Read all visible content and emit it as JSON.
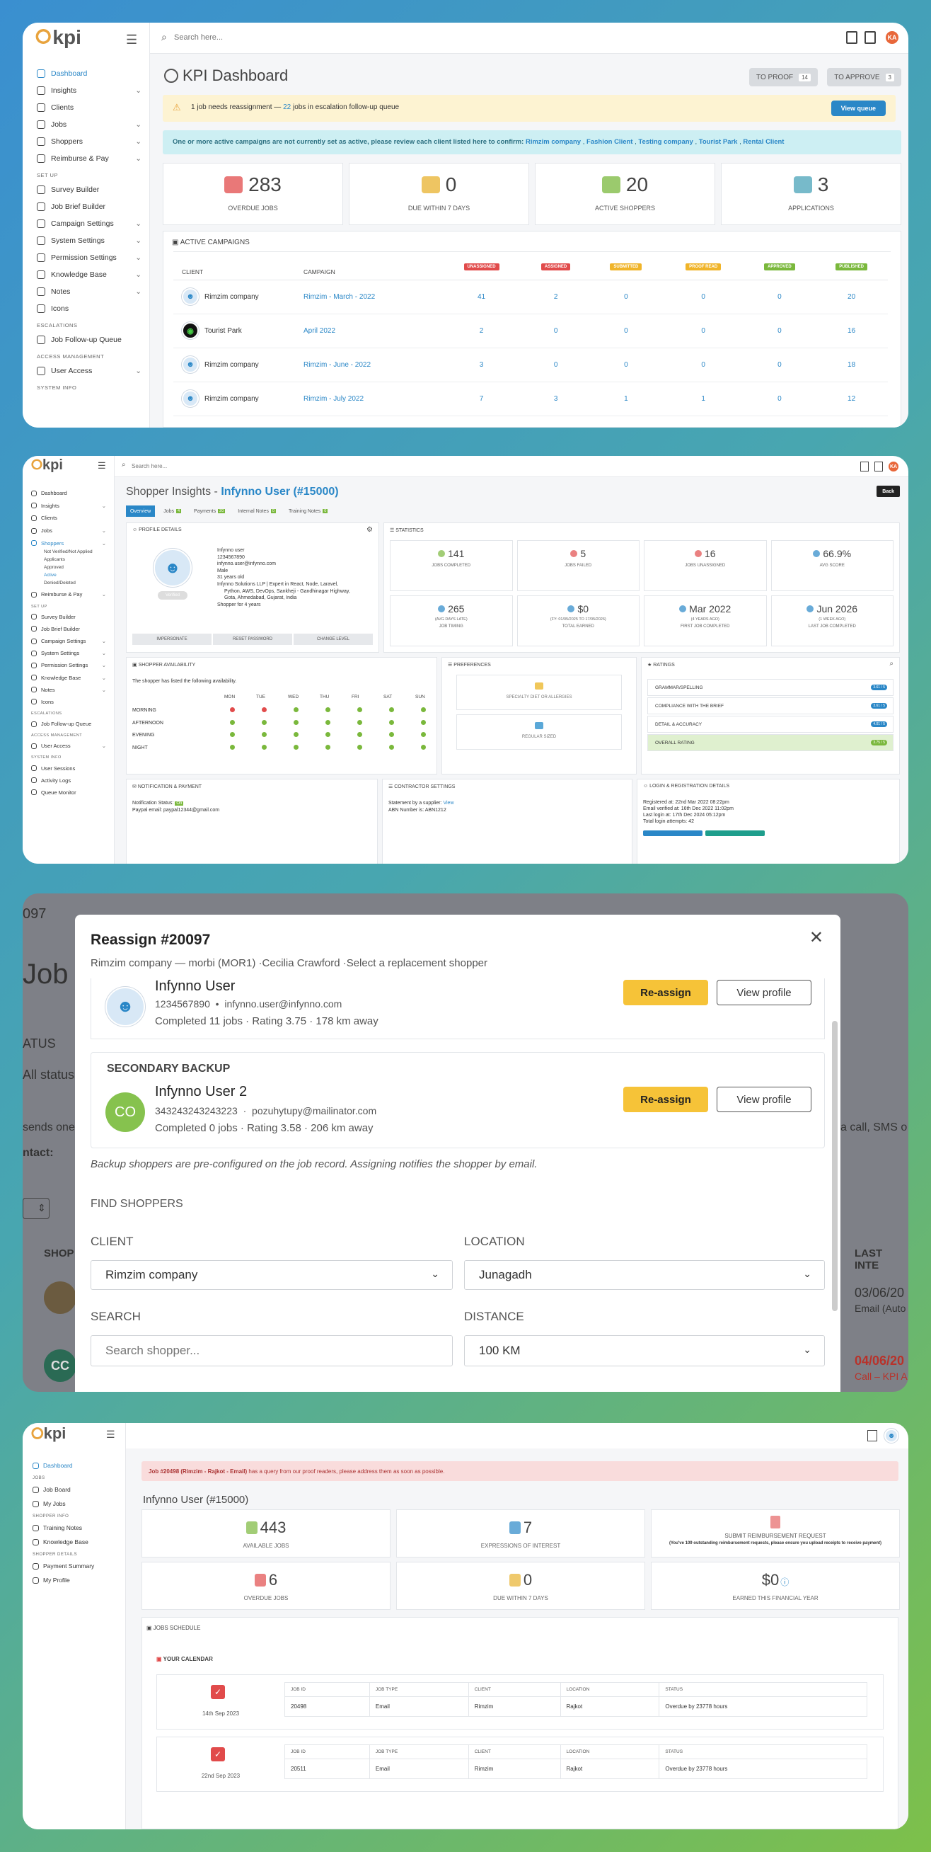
{
  "brand": "kpi",
  "p1": {
    "search_placeholder": "Search here...",
    "user_initials": "KA",
    "sidebar": [
      {
        "label": "Dashboard",
        "active": true
      },
      {
        "label": "Insights",
        "chev": true
      },
      {
        "label": "Clients"
      },
      {
        "label": "Jobs",
        "chev": true
      },
      {
        "label": "Shoppers",
        "chev": true
      },
      {
        "label": "Reimburse & Pay",
        "chev": true
      }
    ],
    "sidebar_setup_title": "SET UP",
    "sidebar_setup": [
      {
        "label": "Survey Builder"
      },
      {
        "label": "Job Brief Builder"
      },
      {
        "label": "Campaign Settings",
        "chev": true
      },
      {
        "label": "System Settings",
        "chev": true
      },
      {
        "label": "Permission Settings",
        "chev": true
      },
      {
        "label": "Knowledge Base",
        "chev": true
      },
      {
        "label": "Notes",
        "chev": true
      },
      {
        "label": "Icons"
      }
    ],
    "sidebar_esc_title": "ESCALATIONS",
    "sidebar_esc": [
      {
        "label": "Job Follow-up Queue"
      }
    ],
    "sidebar_access_title": "ACCESS MANAGEMENT",
    "sidebar_access": [
      {
        "label": "User Access",
        "chev": true
      }
    ],
    "sidebar_sys_title": "SYSTEM INFO",
    "title": "KPI Dashboard",
    "to_proof_label": "TO PROOF",
    "to_proof_count": "14",
    "to_approve_label": "TO APPROVE",
    "to_approve_count": "3",
    "alert_pre": "1 job needs reassignment —",
    "alert_num": "22",
    "alert_post": "jobs in escalation follow-up queue",
    "alert_btn": "View queue",
    "info_text": "One or more active campaigns are not currently set as active, please review each client listed here to confirm:",
    "info_links": [
      "Rimzim company",
      "Fashion Client",
      "Testing company",
      "Tourist Park",
      "Rental Client"
    ],
    "stats": [
      {
        "value": "283",
        "label": "OVERDUE JOBS",
        "icon": "calendar-alert-icon"
      },
      {
        "value": "0",
        "label": "DUE WITHIN 7 DAYS",
        "icon": "calendar-clock-icon"
      },
      {
        "value": "20",
        "label": "ACTIVE SHOPPERS",
        "icon": "users-icon"
      },
      {
        "value": "3",
        "label": "APPLICATIONS",
        "icon": "user-group-icon"
      }
    ],
    "campaigns_title": "ACTIVE CAMPAIGNS",
    "col_client": "CLIENT",
    "col_campaign": "CAMPAIGN",
    "status_cols": [
      {
        "label": "UNASSIGNED",
        "color": "#e14b4b"
      },
      {
        "label": "ASSIGNED",
        "color": "#e14b4b"
      },
      {
        "label": "SUBMITTED",
        "color": "#f0b429"
      },
      {
        "label": "PROOF READ",
        "color": "#f0b429"
      },
      {
        "label": "APPROVED",
        "color": "#7ab83c"
      },
      {
        "label": "PUBLISHED",
        "color": "#7ab83c"
      }
    ],
    "rows": [
      {
        "client": "Rimzim company",
        "campaign": "Rimzim - March - 2022",
        "vals": [
          "41",
          "2",
          "0",
          "0",
          "0",
          "20"
        ]
      },
      {
        "client": "Tourist Park",
        "campaign": "April 2022",
        "vals": [
          "2",
          "0",
          "0",
          "0",
          "0",
          "16"
        ]
      },
      {
        "client": "Rimzim company",
        "campaign": "Rimzim - June - 2022",
        "vals": [
          "3",
          "0",
          "0",
          "0",
          "0",
          "18"
        ]
      },
      {
        "client": "Rimzim company",
        "campaign": "Rimzim - July 2022",
        "vals": [
          "7",
          "3",
          "1",
          "1",
          "0",
          "12"
        ]
      }
    ]
  },
  "p2": {
    "search_placeholder": "Search here...",
    "user_initials": "KA",
    "sidebar": [
      {
        "label": "Dashboard"
      },
      {
        "label": "Insights",
        "chev": true
      },
      {
        "label": "Clients"
      },
      {
        "label": "Jobs",
        "chev": true
      },
      {
        "label": "Shoppers",
        "chev": true,
        "active": true
      }
    ],
    "sidebar_sub": [
      "Not Verified/Not Applied",
      "Applicants",
      "Approved",
      "Active",
      "Denied/Deleted"
    ],
    "sidebar_b": [
      {
        "label": "Reimburse & Pay",
        "chev": true
      }
    ],
    "setup_title": "SET UP",
    "sidebar_setup": [
      {
        "label": "Survey Builder"
      },
      {
        "label": "Job Brief Builder"
      },
      {
        "label": "Campaign Settings",
        "chev": true
      },
      {
        "label": "System Settings",
        "chev": true
      },
      {
        "label": "Permission Settings",
        "chev": true
      },
      {
        "label": "Knowledge Base",
        "chev": true
      },
      {
        "label": "Notes",
        "chev": true
      },
      {
        "label": "Icons"
      }
    ],
    "esc_title": "ESCALATIONS",
    "sidebar_esc": [
      {
        "label": "Job Follow-up Queue"
      }
    ],
    "access_title": "ACCESS MANAGEMENT",
    "sidebar_access": [
      {
        "label": "User Access",
        "chev": true
      }
    ],
    "sys_title": "SYSTEM INFO",
    "sidebar_sys": [
      {
        "label": "User Sessions"
      },
      {
        "label": "Activity Logs"
      },
      {
        "label": "Queue Monitor"
      }
    ],
    "title_pre": "Shopper Insights -",
    "title_user": "Infynno User (#15000)",
    "back": "Back",
    "tabs": [
      {
        "label": "Overview",
        "active": true
      },
      {
        "label": "Jobs",
        "count": "4"
      },
      {
        "label": "Payments",
        "count": "20"
      },
      {
        "label": "Internal Notes",
        "count": "0"
      },
      {
        "label": "Training Notes",
        "count": "0"
      }
    ],
    "profile_title": "PROFILE DETAILS",
    "profile_lines": [
      "Infynno user",
      "1234567890",
      "infynno.user@infynno.com",
      "Male",
      "31 years old",
      "Infynno Solutions LLP | Expert in React, Node, Laravel,",
      "Python, AWS, DevOps, Sankheji - Gandhinagar Highway,",
      "Gota, Ahmedabad, Gujarat, India",
      "Shopper for 4 years"
    ],
    "profile_status": "Verified",
    "profile_actions": [
      "IMPERSONATE",
      "RESET PASSWORD",
      "CHANGE LEVEL"
    ],
    "statistics_title": "STATISTICS",
    "stats": [
      {
        "value": "141",
        "label": "JOBS COMPLETED",
        "sub": ""
      },
      {
        "value": "5",
        "label": "JOBS FAILED",
        "sub": ""
      },
      {
        "value": "16",
        "label": "JOBS UNASSIGNED",
        "sub": ""
      },
      {
        "value": "66.9%",
        "label": "AVG SCORE",
        "sub": ""
      },
      {
        "value": "265",
        "label": "JOB TIMING",
        "sub": "(AVG DAYS LATE)"
      },
      {
        "value": "$0",
        "label": "TOTAL EARNED",
        "sub": "(FY: 01/05/2025 TO 17/05/2026)"
      },
      {
        "value": "Mar 2022",
        "label": "FIRST JOB COMPLETED",
        "sub": "(4 YEARS AGO)"
      },
      {
        "value": "Jun 2026",
        "label": "LAST JOB COMPLETED",
        "sub": "(1 WEEK AGO)"
      }
    ],
    "avail_title": "SHOPPER AVAILABILITY",
    "avail_note": "The shopper has listed the following availability.",
    "days": [
      "MON",
      "TUE",
      "WED",
      "THU",
      "FRI",
      "SAT",
      "SUN"
    ],
    "avail_rows": [
      {
        "label": "MORNING",
        "dots": [
          "r",
          "r",
          "g",
          "g",
          "g",
          "g",
          "g"
        ]
      },
      {
        "label": "AFTERNOON",
        "dots": [
          "g",
          "g",
          "g",
          "g",
          "g",
          "g",
          "g"
        ]
      },
      {
        "label": "EVENING",
        "dots": [
          "g",
          "g",
          "g",
          "g",
          "g",
          "g",
          "g"
        ]
      },
      {
        "label": "NIGHT",
        "dots": [
          "g",
          "g",
          "g",
          "g",
          "g",
          "g",
          "g"
        ]
      }
    ],
    "pref_title": "PREFERENCES",
    "prefs": [
      "SPECIALTY DIET OR ALLERGIES",
      "REGULAR SIZED"
    ],
    "ratings_title": "RATINGS",
    "ratings": [
      {
        "label": "GRAMMAR/SPELLING",
        "score": "3.61 / 5"
      },
      {
        "label": "COMPLIANCE WITH THE BRIEF",
        "score": "3.61 / 5"
      },
      {
        "label": "DETAIL & ACCURACY",
        "score": "4.01 / 5"
      },
      {
        "label": "OVERALL RATING",
        "score": "3.75 / 5"
      }
    ],
    "notif_title": "NOTIFICATION & PAYMENT",
    "notif_status_label": "Notification Status:",
    "notif_status": "On",
    "paypal_label": "Paypal email:",
    "paypal": "paypal12344@gmail.com",
    "contractor_title": "CONTRACTOR SETTINGS",
    "statement_label": "Statement by a supplier:",
    "statement_link": "View",
    "abn_label": "ABN Number is:",
    "abn": "ABN1212",
    "login_title": "LOGIN & REGISTRATION DETAILS",
    "login_lines": [
      {
        "k": "Registered at:",
        "v": "22nd Mar 2022 08:22pm"
      },
      {
        "k": "Email verified at:",
        "v": "16th Dec 2022 11:02pm"
      },
      {
        "k": "Last login at:",
        "v": "17th Dec 2024 05:12pm"
      },
      {
        "k": "Total login attempts:",
        "v": "42"
      }
    ]
  },
  "p3": {
    "bg_code": "097",
    "bg_heading": "Job",
    "bg_status": "ATUS",
    "bg_all": "All status",
    "bg_sends": "sends one",
    "bg_ntact": "ntact:",
    "bg_sms": "a call, SMS o",
    "bg_shop": "SHOP",
    "bg_last": "LAST INTE",
    "bg_date1": "03/06/20",
    "bg_email": "Email (Auto",
    "bg_date2": "04/06/20",
    "bg_call": "Call – KPI A",
    "bg_cc": "CC",
    "modal_title": "Reassign #20097",
    "modal_sub": "Rimzim company — morbi (MOR1) ·Cecilia Crawford ·Select a replacement shopper",
    "s1": {
      "name": "Infynno User",
      "phone": "1234567890",
      "email": "infynno.user@infynno.com",
      "completed": "Completed 11 jobs",
      "rating": "Rating 3.75",
      "distance": "178 km away"
    },
    "secondary_title": "SECONDARY BACKUP",
    "s2": {
      "initials": "CO",
      "name": "Infynno User 2",
      "phone": "343243243243223",
      "email": "pozuhytupy@mailinator.com",
      "completed": "Completed 0 jobs",
      "rating": "Rating 3.58",
      "distance": "206 km away"
    },
    "reassign": "Re-assign",
    "view_profile": "View profile",
    "backup_note": "Backup shoppers are pre-configured on the job record. Assigning notifies the shopper by email.",
    "find_title": "FIND SHOPPERS",
    "client_label": "CLIENT",
    "client_value": "Rimzim company",
    "location_label": "LOCATION",
    "location_value": "Junagadh",
    "search_label": "SEARCH",
    "search_placeholder": "Search shopper...",
    "distance_label": "DISTANCE",
    "distance_value": "100 KM"
  },
  "p4": {
    "sidebar": [
      {
        "label": "Dashboard",
        "active": true
      }
    ],
    "jobs_title": "JOBS",
    "jobs": [
      {
        "label": "Job Board"
      },
      {
        "label": "My Jobs"
      }
    ],
    "info_title": "SHOPPER INFO",
    "info": [
      {
        "label": "Training Notes"
      },
      {
        "label": "Knowledge Base"
      }
    ],
    "details_title": "SHOPPER DETAILS",
    "details": [
      {
        "label": "Payment Summary"
      },
      {
        "label": "My Profile"
      }
    ],
    "alert_bold": "Job #20498 (Rimzim - Rajkot - Email)",
    "alert_rest": "has a query from our proof readers, please address them as soon as possible.",
    "user_title": "Infynno User (#15000)",
    "stats": [
      {
        "value": "443",
        "label": "AVAILABLE JOBS"
      },
      {
        "value": "7",
        "label": "EXPRESSIONS OF INTEREST"
      },
      {
        "value": "6",
        "label": "OVERDUE JOBS"
      },
      {
        "value": "0",
        "label": "DUE WITHIN 7 DAYS"
      },
      {
        "value": "$0",
        "label": "EARNED THIS FINANCIAL YEAR"
      }
    ],
    "reimb_title": "SUBMIT REIMBURSEMENT REQUEST",
    "reimb_note": "(You've 109 outstanding reimbursement requests, please ensure you upload receipts to receive payment)",
    "schedule_title": "JOBS SCHEDULE",
    "calendar_title": "YOUR CALENDAR",
    "cols": [
      "JOB ID",
      "JOB TYPE",
      "CLIENT",
      "LOCATION",
      "STATUS"
    ],
    "entries": [
      {
        "date": "14th Sep 2023",
        "job_id": "20498",
        "job_type": "Email",
        "client": "Rimzim",
        "location": "Rajkot",
        "status": "Overdue by 23778 hours"
      },
      {
        "date": "22nd Sep 2023",
        "job_id": "20511",
        "job_type": "Email",
        "client": "Rimzim",
        "location": "Rajkot",
        "status": "Overdue by 23778 hours"
      }
    ]
  }
}
